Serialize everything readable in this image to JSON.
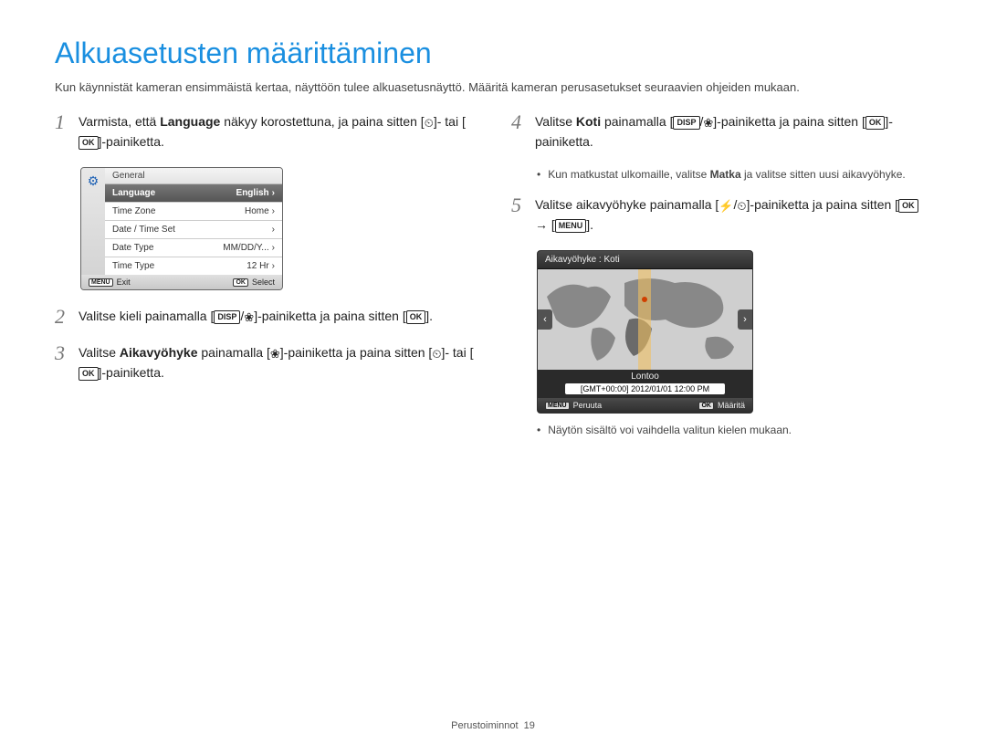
{
  "title": "Alkuasetusten määrittäminen",
  "intro": "Kun käynnistät kameran ensimmäistä kertaa, näyttöön tulee alkuasetusnäyttö. Määritä kameran perusasetukset seuraavien ohjeiden mukaan.",
  "steps": {
    "s1": {
      "num": "1",
      "pre": "Varmista, että ",
      "bold1": "Language",
      "mid": " näkyy korostettuna, ja paina sitten [",
      "icon1": "⏲",
      "mid2": "]- tai [",
      "ok": "OK",
      "post": "]-painiketta."
    },
    "s2": {
      "num": "2",
      "pre": "Valitse kieli painamalla [",
      "disp": "DISP",
      "slash": "/",
      "flower": "❀",
      "mid": "]-painiketta ja paina sitten [",
      "ok": "OK",
      "post": "]."
    },
    "s3": {
      "num": "3",
      "pre": "Valitse ",
      "bold1": "Aikavyöhyke",
      "mid": " painamalla [",
      "flower": "❀",
      "mid2": "]-painiketta ja paina sitten [",
      "timer": "⏲",
      "mid3": "]- tai [",
      "ok": "OK",
      "post": "]-painiketta."
    },
    "s4": {
      "num": "4",
      "pre": "Valitse ",
      "bold1": "Koti",
      "mid": " painamalla [",
      "disp": "DISP",
      "slash": "/",
      "flower": "❀",
      "mid2": "]-painiketta ja paina sitten [",
      "ok": "OK",
      "post": "]-painiketta."
    },
    "s4_sub": "Kun matkustat ulkomaille, valitse Matka ja valitse sitten uusi aikavyöhyke.",
    "s4_sub_bold": "Matka",
    "s5": {
      "num": "5",
      "pre": "Valitse aikavyöhyke painamalla [",
      "flash": "⚡",
      "slash": "/",
      "timer": "⏲",
      "mid": "]-painiketta ja paina sitten [",
      "ok": "OK",
      "arrow": " → ",
      "menu": "MENU",
      "post": "]."
    },
    "s5_sub": "Näytön sisältö voi vaihdella valitun kielen mukaan."
  },
  "menu": {
    "header": "General",
    "rows": [
      {
        "label": "Language",
        "value": "English",
        "sel": true
      },
      {
        "label": "Time Zone",
        "value": "Home",
        "sel": false
      },
      {
        "label": "Date / Time Set",
        "value": "",
        "sel": false
      },
      {
        "label": "Date Type",
        "value": "MM/DD/Y...",
        "sel": false
      },
      {
        "label": "Time Type",
        "value": "12 Hr",
        "sel": false
      }
    ],
    "foot_left_badge": "MENU",
    "foot_left": "Exit",
    "foot_right_badge": "OK",
    "foot_right": "Select"
  },
  "tz": {
    "title": "Aikavyöhyke : Koti",
    "city": "Lontoo",
    "gmt": "[GMT+00:00] 2012/01/01  12:00 PM",
    "foot_left_badge": "MENU",
    "foot_left": "Peruuta",
    "foot_right_badge": "OK",
    "foot_right": "Määritä"
  },
  "footer": {
    "section": "Perustoiminnot",
    "page": "19"
  }
}
